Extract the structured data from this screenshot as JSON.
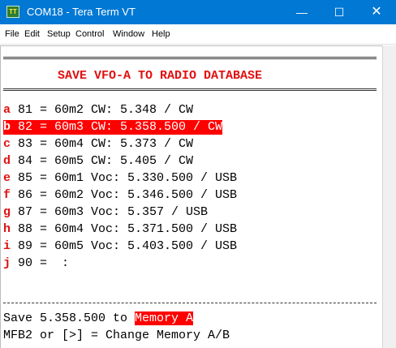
{
  "window": {
    "icon_label": "TT",
    "title": "COM18 - Tera Term VT",
    "minimize_glyph": "—",
    "maximize_glyph": "☐",
    "close_glyph": "✕"
  },
  "menu": [
    "File",
    "Edit",
    "Setup",
    "Control",
    "Window",
    "Help"
  ],
  "terminal": {
    "heading": "SAVE VFO-A TO RADIO DATABASE",
    "entries": [
      {
        "key": "a",
        "text": " 81 = 60m2 CW: 5.348 / CW",
        "selected": false
      },
      {
        "key": "b",
        "text": " 82 = 60m3 CW: 5.358.500 / CW",
        "selected": true
      },
      {
        "key": "c",
        "text": " 83 = 60m4 CW: 5.373 / CW",
        "selected": false
      },
      {
        "key": "d",
        "text": " 84 = 60m5 CW: 5.405 / CW",
        "selected": false
      },
      {
        "key": "e",
        "text": " 85 = 60m1 Voc: 5.330.500 / USB",
        "selected": false
      },
      {
        "key": "f",
        "text": " 86 = 60m2 Voc: 5.346.500 / USB",
        "selected": false
      },
      {
        "key": "g",
        "text": " 87 = 60m3 Voc: 5.357 / USB",
        "selected": false
      },
      {
        "key": "h",
        "text": " 88 = 60m4 Voc: 5.371.500 / USB",
        "selected": false
      },
      {
        "key": "i",
        "text": " 89 = 60m5 Voc: 5.403.500 / USB",
        "selected": false
      },
      {
        "key": "j",
        "text": " 90 =  :",
        "selected": false
      }
    ],
    "save_prefix": "Save 5.358.500 to ",
    "save_target": "Memory A",
    "hint": "MFB2 or [>] = Change Memory A/B"
  },
  "colors": {
    "accent": "#0078d4",
    "key_red": "#e01010",
    "highlight": "#ff0000"
  }
}
